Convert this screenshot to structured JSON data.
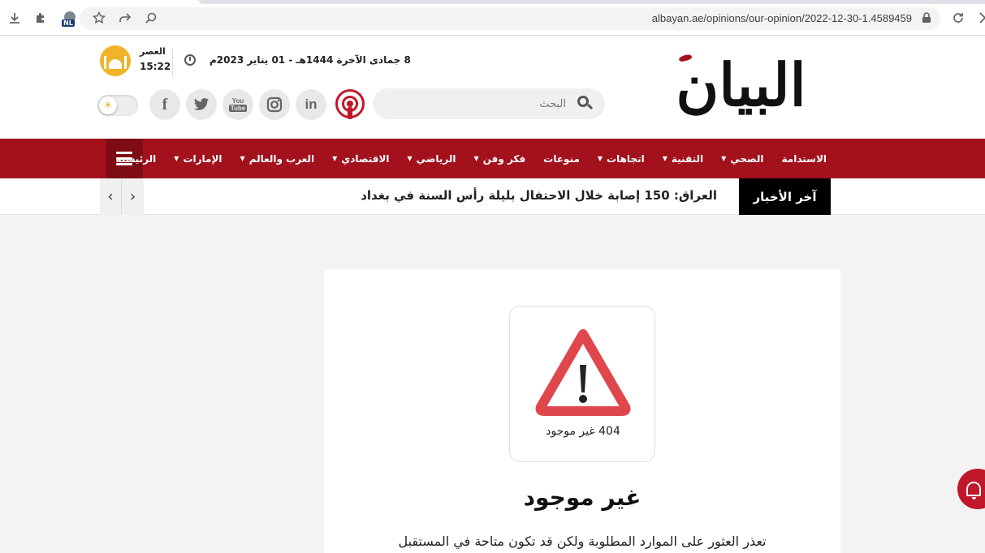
{
  "browser": {
    "url": "albayan.ae/opinions/our-opinion/2022-12-30-1.4589459",
    "extension_badge": "NL"
  },
  "header": {
    "logo_text": "البيان",
    "date": "8 جمادى الآخرة 1444هـ - 01 يناير 2023م",
    "prayer_name": "العصر",
    "prayer_time": "15:22",
    "search_placeholder": "البحث",
    "social": {
      "facebook": "f",
      "twitter": "t",
      "youtube_top": "You",
      "youtube_bottom": "Tube",
      "instagram": "◎",
      "linkedin": "in"
    }
  },
  "nav": {
    "items": [
      {
        "label": "الرئيسية",
        "dropdown": false
      },
      {
        "label": "الإمارات",
        "dropdown": true
      },
      {
        "label": "العرب والعالم",
        "dropdown": true
      },
      {
        "label": "الاقتصادي",
        "dropdown": true
      },
      {
        "label": "الرياضي",
        "dropdown": true
      },
      {
        "label": "فكر وفن",
        "dropdown": true
      },
      {
        "label": "منوعات",
        "dropdown": false
      },
      {
        "label": "اتجاهات",
        "dropdown": true
      },
      {
        "label": "التقنية",
        "dropdown": true
      },
      {
        "label": "الصحي",
        "dropdown": true
      },
      {
        "label": "الاستدامة",
        "dropdown": false
      }
    ],
    "caret": "▼"
  },
  "ticker": {
    "label": "آخر الأخبار",
    "headline": "العراق: 150 إصابة خلال الاحتفال بليلة رأس السنة في بغداد",
    "prev": "‹",
    "next": "›"
  },
  "error": {
    "code_text": "404 غير موجود",
    "title": "غير موجود",
    "description": "تعذر العثور على الموارد المطلوبة ولكن قد تكون متاحة في المستقبل"
  },
  "colors": {
    "brand_red": "#a3111d",
    "dark_red": "#7d0c15",
    "warning_red": "#e0474c",
    "prayer_yellow": "#f0b429"
  }
}
